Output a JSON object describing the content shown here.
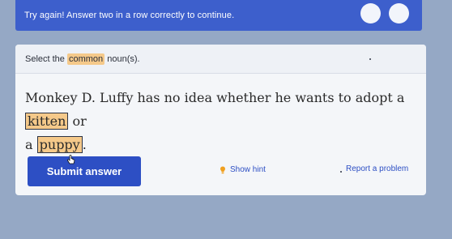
{
  "banner": {
    "message": "Try again! Answer two in a row correctly to continue."
  },
  "question": {
    "prompt_prefix": "Select the",
    "prompt_highlight": "common",
    "prompt_suffix": "noun(s).",
    "sentence_part1": "Monkey D. Luffy has no idea whether he wants to adopt a",
    "word_kitten": "kitten",
    "sentence_part2": "or",
    "sentence_part3": "a",
    "word_puppy": "puppy",
    "sentence_end": "."
  },
  "actions": {
    "submit_label": "Submit answer",
    "hint_label": "Show hint",
    "report_label": "Report a problem"
  },
  "colors": {
    "banner_bg": "#3d5fcc",
    "button_bg": "#2d4fc4",
    "highlight": "#f5c98a",
    "page_bg": "#95a8c5"
  }
}
